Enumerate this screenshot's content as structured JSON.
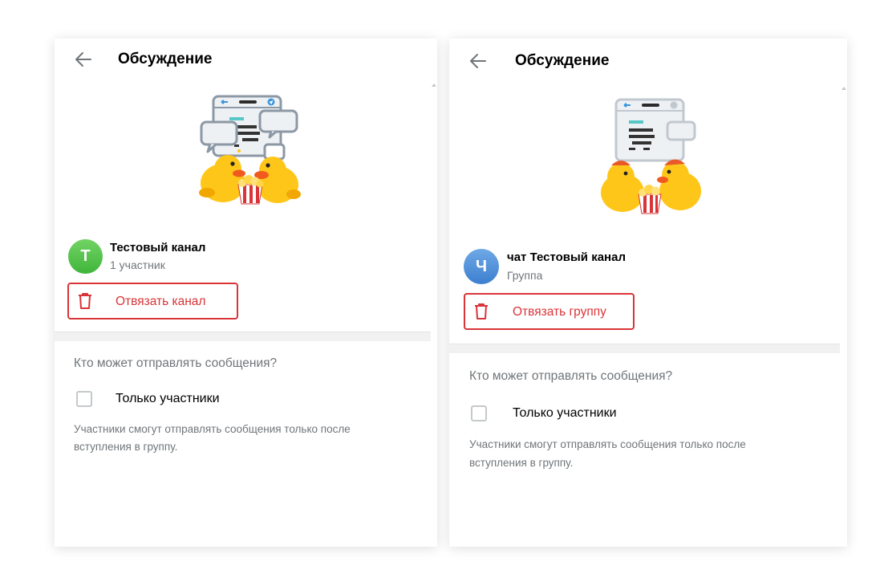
{
  "panels": [
    {
      "title": "Обсуждение",
      "chat": {
        "avatar_letter": "Т",
        "avatar_color": "#4cbb45",
        "name": "Тестовый канал",
        "subtitle": "1 участник"
      },
      "unlink_label": "Отвязать канал",
      "section_heading": "Кто может отправлять сообщения?",
      "checkbox_label": "Только участники",
      "description_lines": [
        "Участники смогут отправлять сообщения только после",
        "вступления в группу."
      ]
    },
    {
      "title": "Обсуждение",
      "chat": {
        "avatar_letter": "Ч",
        "avatar_color": "#4a8bd8",
        "name": "чат Тестовый канал",
        "subtitle": "Группа"
      },
      "unlink_label": "Отвязать группу",
      "section_heading": "Кто может отправлять сообщения?",
      "checkbox_label": "Только участники",
      "description_lines": [
        "Участники смогут отправлять сообщения только после",
        "вступления в группу."
      ]
    }
  ],
  "colors": {
    "accent_red": "#d93438",
    "secondary_text": "#707579",
    "duck_yellow": "#ffc61a",
    "telegram_blue": "#3a96dd"
  },
  "icons": {
    "back": "arrow-left-icon",
    "unlink": "trash-icon",
    "illustration": "ducks-popcorn-discussion-sticker"
  }
}
